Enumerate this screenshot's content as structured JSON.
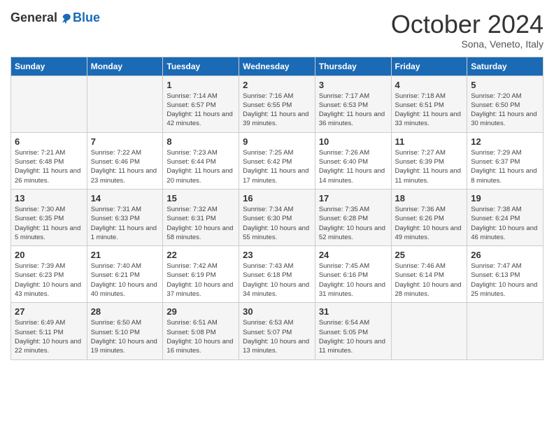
{
  "header": {
    "logo_general": "General",
    "logo_blue": "Blue",
    "month_title": "October 2024",
    "location": "Sona, Veneto, Italy"
  },
  "days_of_week": [
    "Sunday",
    "Monday",
    "Tuesday",
    "Wednesday",
    "Thursday",
    "Friday",
    "Saturday"
  ],
  "weeks": [
    [
      {
        "day": "",
        "info": ""
      },
      {
        "day": "",
        "info": ""
      },
      {
        "day": "1",
        "info": "Sunrise: 7:14 AM\nSunset: 6:57 PM\nDaylight: 11 hours and 42 minutes."
      },
      {
        "day": "2",
        "info": "Sunrise: 7:16 AM\nSunset: 6:55 PM\nDaylight: 11 hours and 39 minutes."
      },
      {
        "day": "3",
        "info": "Sunrise: 7:17 AM\nSunset: 6:53 PM\nDaylight: 11 hours and 36 minutes."
      },
      {
        "day": "4",
        "info": "Sunrise: 7:18 AM\nSunset: 6:51 PM\nDaylight: 11 hours and 33 minutes."
      },
      {
        "day": "5",
        "info": "Sunrise: 7:20 AM\nSunset: 6:50 PM\nDaylight: 11 hours and 30 minutes."
      }
    ],
    [
      {
        "day": "6",
        "info": "Sunrise: 7:21 AM\nSunset: 6:48 PM\nDaylight: 11 hours and 26 minutes."
      },
      {
        "day": "7",
        "info": "Sunrise: 7:22 AM\nSunset: 6:46 PM\nDaylight: 11 hours and 23 minutes."
      },
      {
        "day": "8",
        "info": "Sunrise: 7:23 AM\nSunset: 6:44 PM\nDaylight: 11 hours and 20 minutes."
      },
      {
        "day": "9",
        "info": "Sunrise: 7:25 AM\nSunset: 6:42 PM\nDaylight: 11 hours and 17 minutes."
      },
      {
        "day": "10",
        "info": "Sunrise: 7:26 AM\nSunset: 6:40 PM\nDaylight: 11 hours and 14 minutes."
      },
      {
        "day": "11",
        "info": "Sunrise: 7:27 AM\nSunset: 6:39 PM\nDaylight: 11 hours and 11 minutes."
      },
      {
        "day": "12",
        "info": "Sunrise: 7:29 AM\nSunset: 6:37 PM\nDaylight: 11 hours and 8 minutes."
      }
    ],
    [
      {
        "day": "13",
        "info": "Sunrise: 7:30 AM\nSunset: 6:35 PM\nDaylight: 11 hours and 5 minutes."
      },
      {
        "day": "14",
        "info": "Sunrise: 7:31 AM\nSunset: 6:33 PM\nDaylight: 11 hours and 1 minute."
      },
      {
        "day": "15",
        "info": "Sunrise: 7:32 AM\nSunset: 6:31 PM\nDaylight: 10 hours and 58 minutes."
      },
      {
        "day": "16",
        "info": "Sunrise: 7:34 AM\nSunset: 6:30 PM\nDaylight: 10 hours and 55 minutes."
      },
      {
        "day": "17",
        "info": "Sunrise: 7:35 AM\nSunset: 6:28 PM\nDaylight: 10 hours and 52 minutes."
      },
      {
        "day": "18",
        "info": "Sunrise: 7:36 AM\nSunset: 6:26 PM\nDaylight: 10 hours and 49 minutes."
      },
      {
        "day": "19",
        "info": "Sunrise: 7:38 AM\nSunset: 6:24 PM\nDaylight: 10 hours and 46 minutes."
      }
    ],
    [
      {
        "day": "20",
        "info": "Sunrise: 7:39 AM\nSunset: 6:23 PM\nDaylight: 10 hours and 43 minutes."
      },
      {
        "day": "21",
        "info": "Sunrise: 7:40 AM\nSunset: 6:21 PM\nDaylight: 10 hours and 40 minutes."
      },
      {
        "day": "22",
        "info": "Sunrise: 7:42 AM\nSunset: 6:19 PM\nDaylight: 10 hours and 37 minutes."
      },
      {
        "day": "23",
        "info": "Sunrise: 7:43 AM\nSunset: 6:18 PM\nDaylight: 10 hours and 34 minutes."
      },
      {
        "day": "24",
        "info": "Sunrise: 7:45 AM\nSunset: 6:16 PM\nDaylight: 10 hours and 31 minutes."
      },
      {
        "day": "25",
        "info": "Sunrise: 7:46 AM\nSunset: 6:14 PM\nDaylight: 10 hours and 28 minutes."
      },
      {
        "day": "26",
        "info": "Sunrise: 7:47 AM\nSunset: 6:13 PM\nDaylight: 10 hours and 25 minutes."
      }
    ],
    [
      {
        "day": "27",
        "info": "Sunrise: 6:49 AM\nSunset: 5:11 PM\nDaylight: 10 hours and 22 minutes."
      },
      {
        "day": "28",
        "info": "Sunrise: 6:50 AM\nSunset: 5:10 PM\nDaylight: 10 hours and 19 minutes."
      },
      {
        "day": "29",
        "info": "Sunrise: 6:51 AM\nSunset: 5:08 PM\nDaylight: 10 hours and 16 minutes."
      },
      {
        "day": "30",
        "info": "Sunrise: 6:53 AM\nSunset: 5:07 PM\nDaylight: 10 hours and 13 minutes."
      },
      {
        "day": "31",
        "info": "Sunrise: 6:54 AM\nSunset: 5:05 PM\nDaylight: 10 hours and 11 minutes."
      },
      {
        "day": "",
        "info": ""
      },
      {
        "day": "",
        "info": ""
      }
    ]
  ]
}
